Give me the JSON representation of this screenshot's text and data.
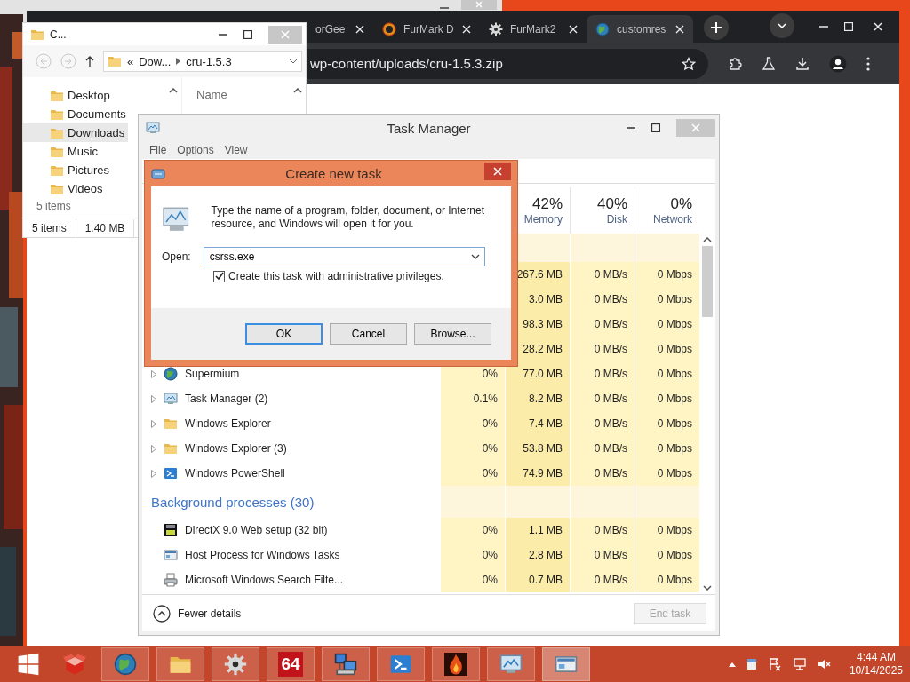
{
  "browser": {
    "tabs": [
      {
        "kind": "cut",
        "title": "orGee",
        "selected": false
      },
      {
        "kind": "ring",
        "title": "FurMark D",
        "selected": false
      },
      {
        "kind": "gear",
        "title": "FurMark2",
        "selected": false
      },
      {
        "kind": "globe",
        "title": "customres",
        "selected": true
      }
    ],
    "url": "wp-content/uploads/cru-1.5.3.zip"
  },
  "explorer": {
    "title": "C...",
    "breadcrumb_overflow": "«",
    "breadcrumb": [
      "Dow...",
      "cru-1.5.3"
    ],
    "nav": [
      {
        "label": "Desktop",
        "selected": false
      },
      {
        "label": "Documents",
        "selected": false
      },
      {
        "label": "Downloads",
        "selected": true
      },
      {
        "label": "Music",
        "selected": false
      },
      {
        "label": "Pictures",
        "selected": false
      },
      {
        "label": "Videos",
        "selected": false
      }
    ],
    "item_count": "5 items",
    "column": "Name",
    "status": [
      "5 items",
      "1.40 MB"
    ]
  },
  "task_manager": {
    "title": "Task Manager",
    "menu": [
      "File",
      "Options",
      "View"
    ],
    "columns": [
      {
        "percent": "42%",
        "label": "Memory"
      },
      {
        "percent": "40%",
        "label": "Disk"
      },
      {
        "percent": "0%",
        "label": "Network"
      }
    ],
    "rows": [
      {
        "kind": "group"
      },
      {
        "kind": "covered",
        "memory": "267.6 MB",
        "disk": "0 MB/s",
        "network": "0 Mbps"
      },
      {
        "kind": "covered",
        "memory": "3.0 MB",
        "disk": "0 MB/s",
        "network": "0 Mbps"
      },
      {
        "kind": "covered",
        "memory": "98.3 MB",
        "disk": "0 MB/s",
        "network": "0 Mbps"
      },
      {
        "kind": "covered",
        "memory": "28.2 MB",
        "disk": "0 MB/s",
        "network": "0 Mbps"
      },
      {
        "kind": "browser",
        "expandable": true,
        "name": "Supermium",
        "cpu": "0%",
        "memory": "77.0 MB",
        "disk": "0 MB/s",
        "network": "0 Mbps"
      },
      {
        "kind": "monitor",
        "expandable": true,
        "name": "Task Manager (2)",
        "cpu": "0.1%",
        "memory": "8.2 MB",
        "disk": "0 MB/s",
        "network": "0 Mbps"
      },
      {
        "kind": "explorer",
        "expandable": true,
        "name": "Windows Explorer",
        "cpu": "0%",
        "memory": "7.4 MB",
        "disk": "0 MB/s",
        "network": "0 Mbps"
      },
      {
        "kind": "explorer",
        "expandable": true,
        "name": "Windows Explorer (3)",
        "cpu": "0%",
        "memory": "53.8 MB",
        "disk": "0 MB/s",
        "network": "0 Mbps"
      },
      {
        "kind": "terminal",
        "expandable": true,
        "name": "Windows PowerShell",
        "cpu": "0%",
        "memory": "74.9 MB",
        "disk": "0 MB/s",
        "network": "0 Mbps"
      },
      {
        "kind": "group",
        "name": "Background processes (30)"
      },
      {
        "kind": "setup",
        "expandable": false,
        "name": "DirectX 9.0 Web setup (32 bit)",
        "cpu": "0%",
        "memory": "1.1 MB",
        "disk": "0 MB/s",
        "network": "0 Mbps"
      },
      {
        "kind": "host",
        "expandable": false,
        "name": "Host Process for Windows Tasks",
        "cpu": "0%",
        "memory": "2.8 MB",
        "disk": "0 MB/s",
        "network": "0 Mbps"
      },
      {
        "kind": "printer",
        "expandable": false,
        "name": "Microsoft Windows Search Filte...",
        "cpu": "0%",
        "memory": "0.7 MB",
        "disk": "0 MB/s",
        "network": "0 Mbps"
      }
    ],
    "fewer_details": "Fewer details",
    "end_task": {
      "label": "End task",
      "disabled": true
    }
  },
  "dialog": {
    "title": "Create new task",
    "message": "Type the name of a program, folder, document, or Internet resource, and Windows will open it for you.",
    "open_label": "Open:",
    "value": "csrss.exe",
    "admin": {
      "label": "Create this task with administrative privileges.",
      "checked": true
    },
    "buttons": [
      {
        "label": "OK",
        "default": true
      },
      {
        "label": "Cancel",
        "default": false
      },
      {
        "label": "Browse...",
        "default": false
      }
    ]
  },
  "taskbar": {
    "items": [
      {
        "kind": "start",
        "running": false,
        "selected": false
      },
      {
        "kind": "box",
        "running": false,
        "selected": false
      },
      {
        "kind": "globe",
        "running": true,
        "selected": false
      },
      {
        "kind": "folder",
        "running": true,
        "selected": false
      },
      {
        "kind": "gear",
        "running": true,
        "selected": false
      },
      {
        "kind": "badge",
        "label": "64",
        "running": true,
        "selected": false
      },
      {
        "kind": "computers",
        "running": true,
        "selected": false
      },
      {
        "kind": "terminal",
        "running": true,
        "selected": false
      },
      {
        "kind": "flame",
        "running": true,
        "selected": false
      },
      {
        "kind": "monitor",
        "running": true,
        "selected": false
      },
      {
        "kind": "window",
        "running": true,
        "selected": true
      }
    ],
    "time": "4:44 AM",
    "date": "10/14/2025"
  }
}
